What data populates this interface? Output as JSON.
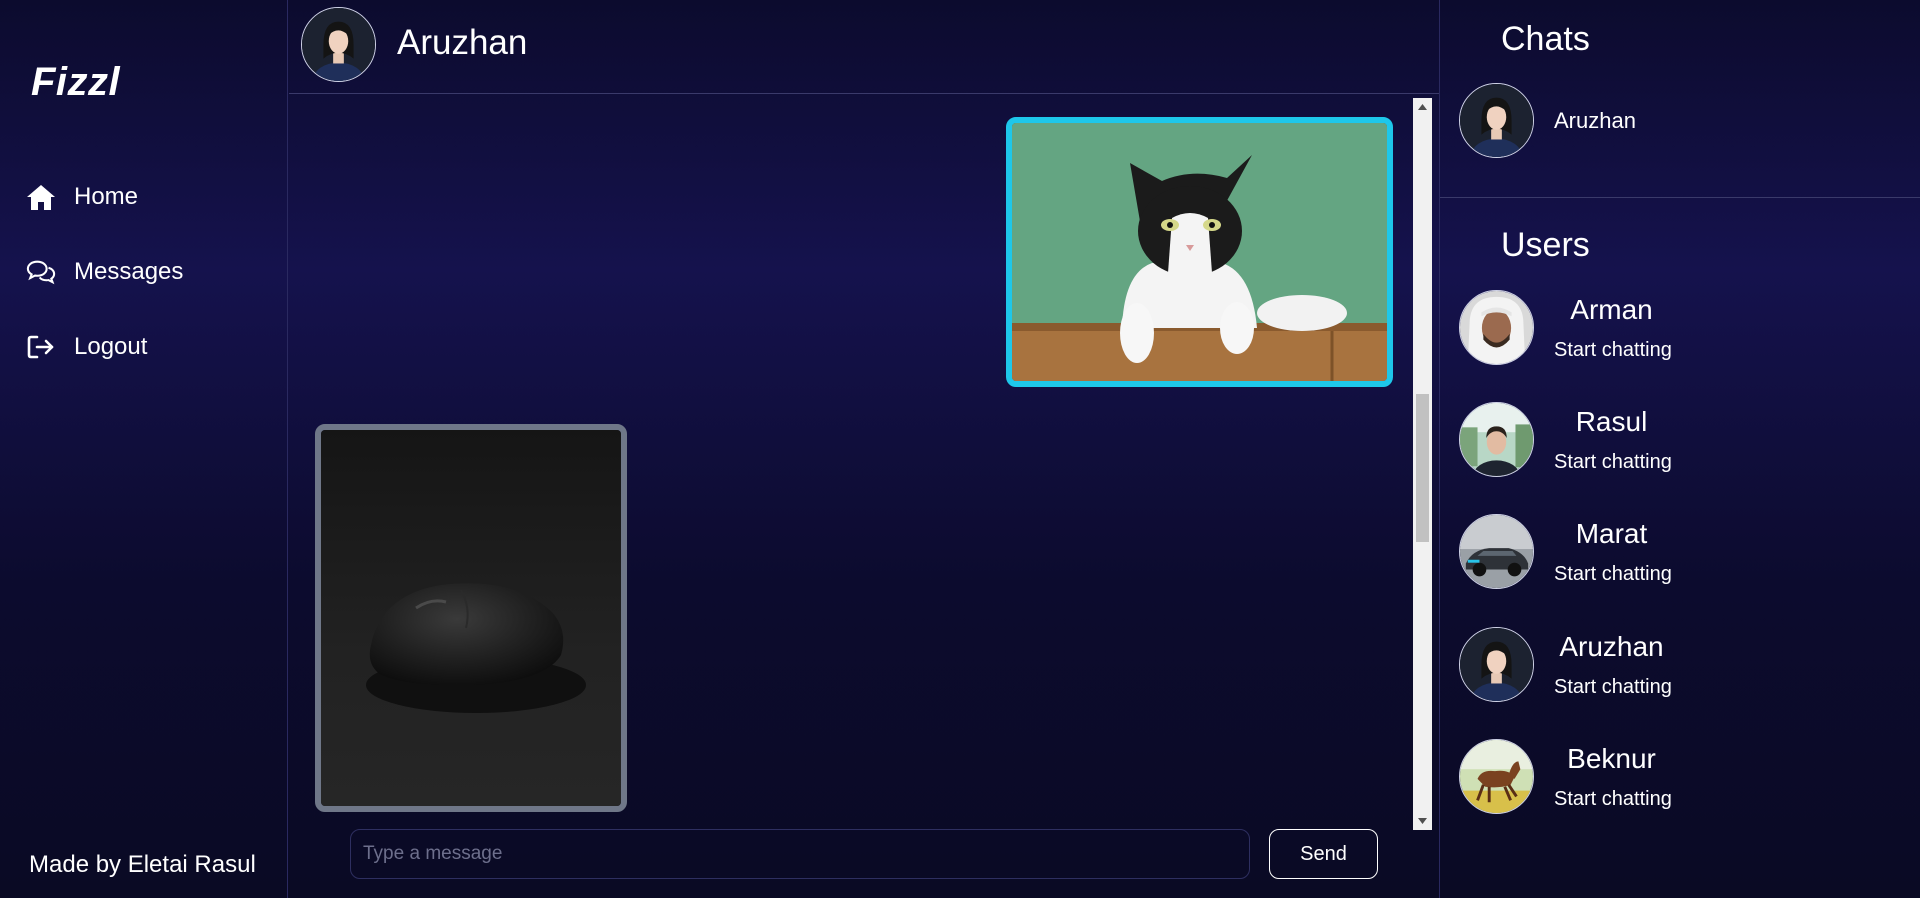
{
  "app": {
    "brand": "Fizzl",
    "footer": "Made by Eletai Rasul"
  },
  "nav": [
    {
      "label": "Home",
      "icon": "home-icon"
    },
    {
      "label": "Messages",
      "icon": "messages-icon"
    },
    {
      "label": "Logout",
      "icon": "logout-icon"
    }
  ],
  "chat": {
    "title": "Aruzhan",
    "input_placeholder": "Type a message",
    "send_label": "Send"
  },
  "messages": [
    {
      "direction": "sent",
      "content": "cat-photo",
      "border_color": "#1ec7ea"
    },
    {
      "direction": "received",
      "content": "mouse-photo",
      "border_color": "#6f7788"
    }
  ],
  "sidebar": {
    "chats_title": "Chats",
    "chats": [
      {
        "name": "Aruzhan"
      }
    ],
    "users_title": "Users",
    "users": [
      {
        "name": "Arman",
        "subtitle": "Start chatting"
      },
      {
        "name": "Rasul",
        "subtitle": "Start chatting"
      },
      {
        "name": "Marat",
        "subtitle": "Start chatting"
      },
      {
        "name": "Aruzhan",
        "subtitle": "Start chatting"
      },
      {
        "name": "Beknur",
        "subtitle": "Start chatting"
      }
    ]
  },
  "colors": {
    "background": "#0c0b2e",
    "sent_border": "#1ec7ea",
    "received_border": "#6f7788"
  }
}
